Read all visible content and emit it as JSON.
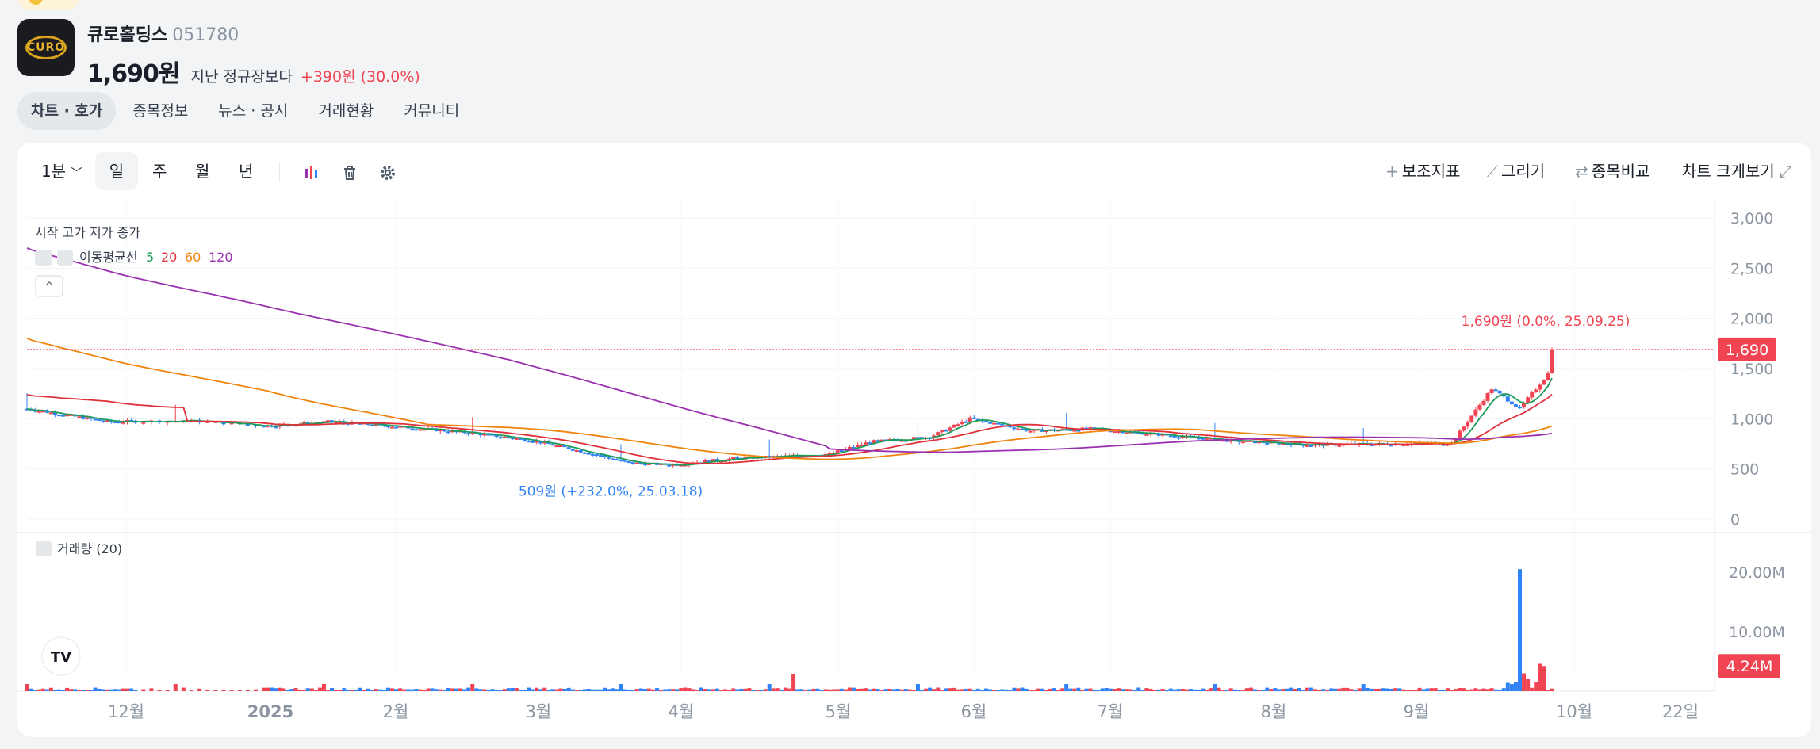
{
  "stock": {
    "name": "큐로홀딩스",
    "code": "051780",
    "price": "1,690원",
    "compare_label": "지난 정규장보다",
    "change": "+390원 (30.0%)",
    "logo_text": "CURO"
  },
  "tabs": [
    "차트 · 호가",
    "종목정보",
    "뉴스 · 공시",
    "거래현황",
    "커뮤니티"
  ],
  "toolbar": {
    "interval": "1분",
    "periods": [
      "일",
      "주",
      "월",
      "년"
    ],
    "right": [
      "보조지표",
      "그리기",
      "종목비교",
      "차트 크게보기"
    ]
  },
  "legend": {
    "ohlc": "시작 고가 저가 종가",
    "ma_label": "이동평균선",
    "ma_periods": [
      "5",
      "20",
      "60",
      "120"
    ],
    "volume_label": "거래량 (20)"
  },
  "chart_data": {
    "type": "candlestick",
    "x_labels": [
      "12월",
      "2025",
      "2월",
      "3월",
      "4월",
      "5월",
      "6월",
      "7월",
      "8월",
      "9월",
      "10월",
      "22일"
    ],
    "y_ticks": [
      "3,000",
      "2,500",
      "2,000",
      "1,500",
      "1,000",
      "500",
      "0"
    ],
    "ylim": [
      0,
      3000
    ],
    "volume_ticks": [
      "20.00M",
      "10.00M"
    ],
    "current_price_label": "1,690",
    "current_volume_label": "4.24M",
    "annotations": {
      "high": "1,690원 (0.0%, 25.09.25)",
      "low": "509원 (+232.0%, 25.03.18)"
    },
    "ma_colors": {
      "5": "#1a9b57",
      "20": "#e0313b",
      "60": "#f0840e",
      "120": "#9b30b0"
    }
  },
  "colors": {
    "up": "#f04452",
    "down": "#3182f6",
    "accent": "#f04452"
  }
}
